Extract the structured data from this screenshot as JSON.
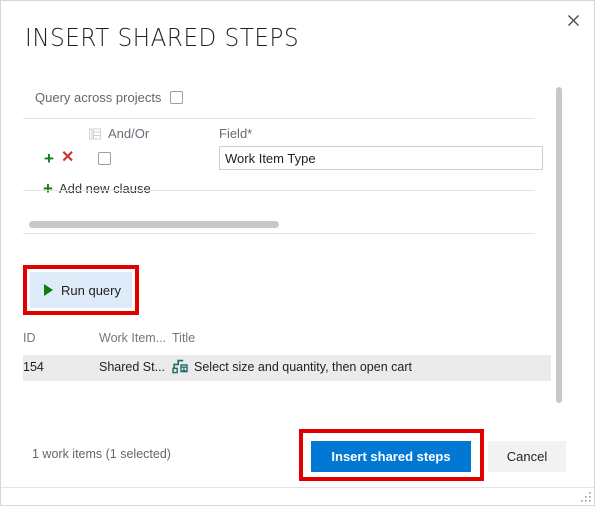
{
  "dialog": {
    "title": "INSERT SHARED STEPS",
    "close_label": "×",
    "close_icon": "close-icon"
  },
  "query": {
    "across_projects_label": "Query across projects",
    "across_projects_checked": false,
    "columns_icon": "columns-icon",
    "headers": {
      "and_or": "And/Or",
      "field": "Field*"
    },
    "clause": {
      "add_icon": "+",
      "remove_icon": "✕",
      "checked": false,
      "field_value": "Work Item Type",
      "field_placeholder": "Work Item Type"
    },
    "add_new_clause": {
      "icon": "+",
      "label": "Add new clause"
    },
    "run_query": {
      "label": "Run query",
      "icon": "play-icon"
    }
  },
  "results": {
    "columns": [
      "ID",
      "Work Item...",
      "Title"
    ],
    "rows": [
      {
        "id": "154",
        "work_item_type": "Shared St...",
        "title": "Select size and quantity, then open cart",
        "icon": "shared-steps-icon",
        "selected": true
      }
    ]
  },
  "footer": {
    "status": "1 work items (1 selected)",
    "primary_button": "Insert shared steps",
    "cancel_button": "Cancel"
  },
  "colors": {
    "accent_blue": "#0078d4",
    "run_query_bg": "#deecf9",
    "green": "#107c10",
    "red": "#d13438",
    "annotation_red": "#e00000",
    "selected_row": "#ebebeb",
    "shared_steps_icon": "#1f6b6b"
  }
}
